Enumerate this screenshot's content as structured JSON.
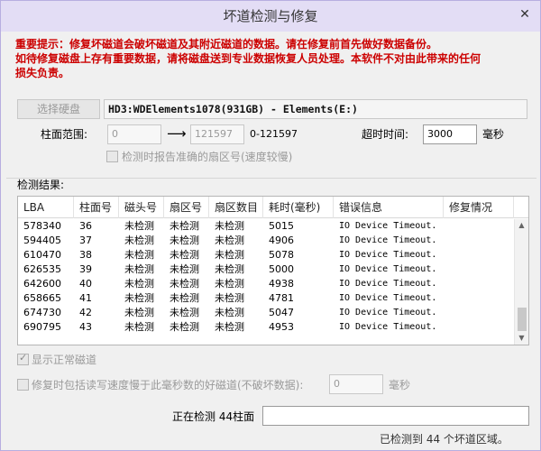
{
  "window": {
    "title": "坏道检测与修复",
    "close_icon": "✕"
  },
  "warning": {
    "line1": "重要提示：修复坏磁道会破坏磁道及其附近磁道的数据。请在修复前首先做好数据备份。",
    "line2": "如待修复磁盘上存有重要数据，请将磁盘送到专业数据恢复人员处理。本软件不对由此带来的任何",
    "line3": "损失负责。"
  },
  "disk": {
    "select_button": "选择硬盘",
    "info": "HD3:WDElements1078(931GB) - Elements(E:)"
  },
  "range": {
    "label": "柱面范围:",
    "from": "0",
    "arrow": "⟶",
    "to": "121597",
    "hint": "0-121597"
  },
  "timeout": {
    "label": "超时时间:",
    "value": "3000",
    "unit": "毫秒"
  },
  "accurate_option": {
    "label": "检测时报告准确的扇区号(速度较慢)",
    "checked": false
  },
  "results": {
    "label": "检测结果:",
    "columns": [
      "LBA",
      "柱面号",
      "磁头号",
      "扇区号",
      "扇区数目",
      "耗时(毫秒)",
      "错误信息",
      "修复情况"
    ],
    "rows": [
      [
        "578340",
        "36",
        "未检测",
        "未检测",
        "未检测",
        "5015",
        "IO Device Timeout.",
        ""
      ],
      [
        "594405",
        "37",
        "未检测",
        "未检测",
        "未检测",
        "4906",
        "IO Device Timeout.",
        ""
      ],
      [
        "610470",
        "38",
        "未检测",
        "未检测",
        "未检测",
        "5078",
        "IO Device Timeout.",
        ""
      ],
      [
        "626535",
        "39",
        "未检测",
        "未检测",
        "未检测",
        "5000",
        "IO Device Timeout.",
        ""
      ],
      [
        "642600",
        "40",
        "未检测",
        "未检测",
        "未检测",
        "4938",
        "IO Device Timeout.",
        ""
      ],
      [
        "658665",
        "41",
        "未检测",
        "未检测",
        "未检测",
        "4781",
        "IO Device Timeout.",
        ""
      ],
      [
        "674730",
        "42",
        "未检测",
        "未检测",
        "未检测",
        "5047",
        "IO Device Timeout.",
        ""
      ],
      [
        "690795",
        "43",
        "未检测",
        "未检测",
        "未检测",
        "4953",
        "IO Device Timeout.",
        ""
      ]
    ]
  },
  "show_normal": {
    "label": "显示正常磁道",
    "checked": true
  },
  "repair_slow": {
    "label": "修复时包括读写速度慢于此毫秒数的好磁道(不破坏数据):",
    "value": "0",
    "unit": "毫秒",
    "checked": false
  },
  "status": {
    "label": "正在检测 44柱面",
    "value": ""
  },
  "footer": {
    "text": "已检测到 44 个坏道区域。"
  },
  "colors": {
    "warning": "#cc0000",
    "titlebar": "#e3ddf5"
  }
}
